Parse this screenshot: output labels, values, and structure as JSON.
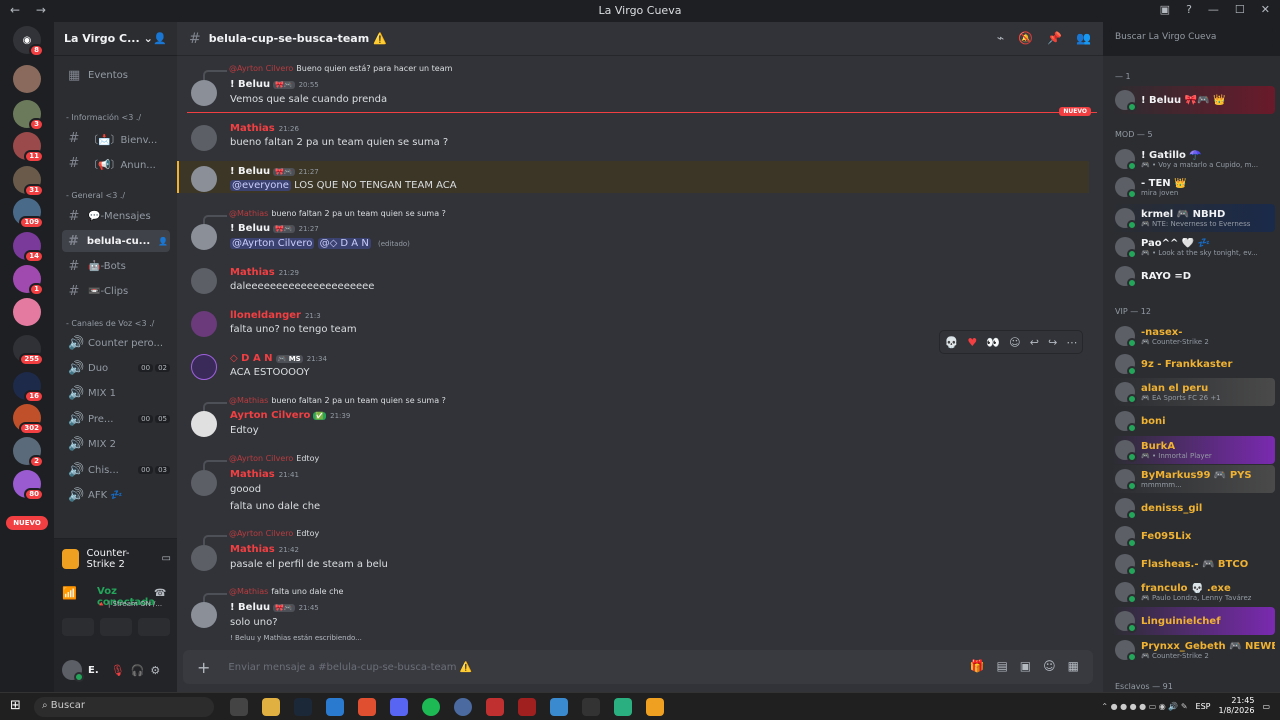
{
  "window": {
    "title": "La Virgo Cueva"
  },
  "server": {
    "name": "La Virgo C..."
  },
  "channels": {
    "events": "Eventos",
    "cat_info": "- Información <3 ./",
    "welcome": "〔📩〕Bienv...",
    "announce": "〔📢〕Anun...",
    "cat_general": "- General <3 ./",
    "mensajes": "💬-Mensajes",
    "active": "belula-cu...",
    "bots": "🤖-Bots",
    "clips": "📼-Clips",
    "cat_voice": "- Canales de Voz <3 ./",
    "voice": [
      {
        "name": "Counter pero...",
        "c1": "",
        "c2": ""
      },
      {
        "name": "Duo",
        "c1": "00",
        "c2": "02"
      },
      {
        "name": "MIX 1",
        "c1": "",
        "c2": ""
      },
      {
        "name": "Pre...",
        "c1": "00",
        "c2": "05"
      },
      {
        "name": "MIX 2",
        "c1": "",
        "c2": ""
      },
      {
        "name": "Chis...",
        "c1": "00",
        "c2": "03"
      },
      {
        "name": "AFK 💤",
        "c1": "",
        "c2": ""
      }
    ]
  },
  "guild_badges": [
    "8",
    "3",
    "11",
    "31",
    "109",
    "14",
    "1",
    "255",
    "16",
    "302",
    "2",
    "80"
  ],
  "guild_new": "NUEVO",
  "game": {
    "name": "Counter-Strike 2"
  },
  "voice": {
    "status": "Voz conectada",
    "sub": "🔺 | Stream ON /..."
  },
  "user": {
    "name": "E."
  },
  "channel": {
    "name": "belula-cup-se-busca-team ⚠️"
  },
  "search": {
    "placeholder": "Buscar La Virgo Cueva"
  },
  "new_label": "NUEVO",
  "messages": [
    {
      "reply_name": "@Ayrton Cilvero",
      "reply_text": "Bueno quien está? para hacer un team",
      "user": "! Beluu",
      "tag": "🎀🎮",
      "ts": "20:55",
      "text": "Vemos que sale cuando prenda",
      "color": "#f2f3f5"
    },
    {
      "user": "Mathias",
      "ts": "21:26",
      "text": "bueno faltan 2 pa un team quien se suma ?",
      "color": "#f23f42"
    },
    {
      "user": "! Beluu",
      "tag": "🎀🎮",
      "ts": "21:27",
      "mention": "@everyone",
      "text": "LOS QUE NO TENGAN TEAM ACA",
      "color": "#f2f3f5"
    },
    {
      "reply_name": "@Mathias",
      "reply_text": "bueno faltan 2 pa un team quien se suma ?",
      "user": "! Beluu",
      "tag": "🎀🎮",
      "ts": "21:27",
      "mention1": "@Ayrton Cilvero",
      "mention2": "@◇ D A N",
      "edited": "(editado)",
      "color": "#f2f3f5"
    },
    {
      "user": "Mathias",
      "ts": "21:29",
      "text": "daleeeeeeeeeeeeeeeeeeeee",
      "color": "#f23f42"
    },
    {
      "user": "lloneldanger",
      "ts": "21:3",
      "text": "falta uno? no tengo team",
      "color": "#f23f42"
    },
    {
      "user": "◇ D A N",
      "tag": "🎮 MS",
      "ts": "21:34",
      "text": "ACA ESTOOOOY",
      "color": "#f23f42"
    },
    {
      "reply_name": "@Mathias",
      "reply_text": "bueno faltan 2 pa un team quien se suma ?",
      "user": "Ayrton Cilvero",
      "tag": "✅",
      "ts": "21:39",
      "text": "Edtoy",
      "color": "#f23f42"
    },
    {
      "reply_name": "@Ayrton Cilvero",
      "reply_text": "Edtoy",
      "user": "Mathias",
      "ts": "21:41",
      "text": "goood",
      "text2": "falta uno dale che",
      "color": "#f23f42"
    },
    {
      "reply_name": "@Ayrton Cilvero",
      "reply_text": "Edtoy",
      "user": "Mathias",
      "ts": "21:42",
      "text": "pasale el perfil de steam a belu",
      "color": "#f23f42"
    },
    {
      "reply_name": "@Mathias",
      "reply_text": "falta uno dale che",
      "user": "! Beluu",
      "tag": "🎀🎮",
      "ts": "21:45",
      "text": "solo uno?",
      "color": "#f2f3f5"
    }
  ],
  "typing": "! Beluu y Mathias están escribiendo...",
  "composer": {
    "placeholder": "Enviar mensaje a #belula-cup-se-busca-team ⚠️"
  },
  "members": {
    "cat1": "— 1",
    "top": {
      "name": "! Beluu 🎀🎮 👑",
      "color": "#f2f3f5"
    },
    "cat_mod": "MOD — 5",
    "mods": [
      {
        "name": "! Gatillo ☂️",
        "sub": "🎮 • Voy a matarlo a Cupido, m...",
        "color": "#f2f3f5"
      },
      {
        "name": "- TEN 👑",
        "sub": "mira joven",
        "color": "#f2f3f5"
      },
      {
        "name": "krmel 🎮 NBHD",
        "sub": "🎮 NTE: Neverness to Everness",
        "color": "#f2f3f5"
      },
      {
        "name": "Pao^^ 🤍 💤",
        "sub": "🎮 • Look at the sky tonight, ev...",
        "color": "#f2f3f5"
      },
      {
        "name": "RAYO =D",
        "sub": "",
        "color": "#f2f3f5"
      }
    ],
    "cat_vip": "VIP — 12",
    "vips": [
      {
        "name": "-nasex-",
        "sub": "🎮 Counter-Strike 2"
      },
      {
        "name": "9z - Frankkaster",
        "sub": ""
      },
      {
        "name": "alan el peru",
        "sub": "🎮 EA Sports FC 26 +1"
      },
      {
        "name": "boni",
        "sub": ""
      },
      {
        "name": "BurkA",
        "sub": "🎮 • Inmortal Player"
      },
      {
        "name": "ByMarkus99 🎮 PYS",
        "sub": "mmmmm..."
      },
      {
        "name": "denisss_gil",
        "sub": ""
      },
      {
        "name": "Fe095Lix",
        "sub": ""
      },
      {
        "name": "Flasheas.- 🎮 BTCO",
        "sub": ""
      },
      {
        "name": "franculo 💀 .exe",
        "sub": "🎮 Paulo Londra, Lenny Tavárez"
      },
      {
        "name": "Linguinielchef",
        "sub": ""
      },
      {
        "name": "Prynxx_Gebeth 🎮 NEWB",
        "sub": "🎮 Counter-Strike 2"
      }
    ],
    "cat_esc": "Esclavos — 91",
    "vip_color": "#f0b232"
  },
  "taskbar": {
    "search": "Buscar",
    "lang": "ESP",
    "time": "21:45",
    "date": "1/8/2026"
  }
}
